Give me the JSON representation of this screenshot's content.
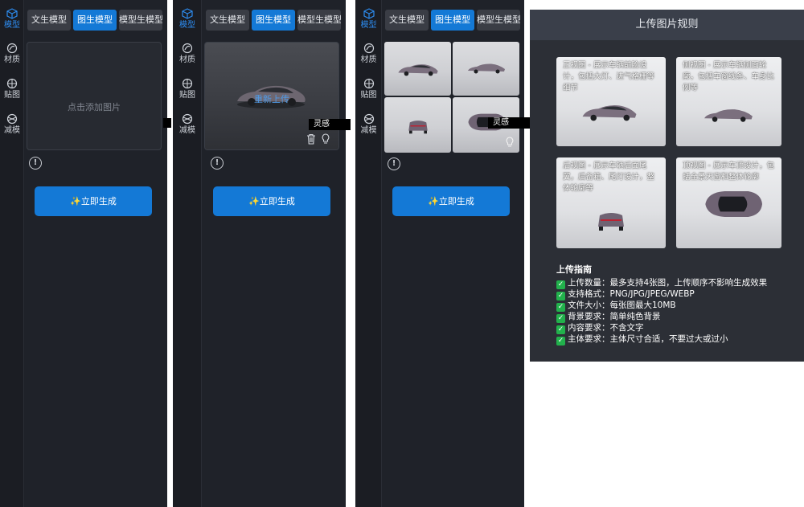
{
  "sidebar": {
    "items": [
      {
        "label": "模型",
        "icon": "cube-icon"
      },
      {
        "label": "材质",
        "icon": "material-icon"
      },
      {
        "label": "贴图",
        "icon": "texture-icon"
      },
      {
        "label": "减模",
        "icon": "reduce-icon"
      }
    ]
  },
  "tabs": [
    "文生模型",
    "图生模型",
    "模型生模型"
  ],
  "upload": {
    "placeholder": "点击添加图片",
    "reupload_label": "重新上传",
    "tooltip": "灵感"
  },
  "generate_label": "✨立即生成",
  "rules": {
    "title": "上传图片规则",
    "cards": [
      {
        "text": "正视图 - 展示车辆前脸设计，包括大灯、进气格栅等细节"
      },
      {
        "text": "侧视图 - 展示车辆侧面轮廓，包括车窗线条、车身比例等"
      },
      {
        "text": "后视图 - 展示车辆后面尾翼，后备箱、尾灯设计，整体轮廓等"
      },
      {
        "text": "顶视图 - 展示车顶设计，包括全景天窗和整体轮廓"
      }
    ],
    "guide_title": "上传指南",
    "guide": [
      "上传数量：最多支持4张图，上传顺序不影响生成效果",
      "支持格式：PNG/JPG/JPEG/WEBP",
      "文件大小：每张图最大10MB",
      "背景要求：简单纯色背景",
      "内容要求：不含文字",
      "主体要求：主体尺寸合适，不要过大或过小"
    ]
  },
  "colors": {
    "panel_bg": "#1f2229",
    "accent": "#1479d6",
    "tab_bg": "#3a3d45",
    "check": "#22b14c"
  }
}
